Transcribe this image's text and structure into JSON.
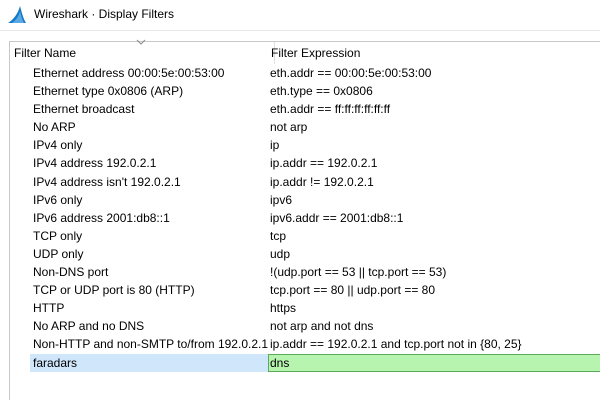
{
  "window": {
    "title": "Wireshark · Display Filters",
    "icon": "wireshark-fin-icon",
    "accent_color": "#1679c8"
  },
  "table": {
    "columns": {
      "name": "Filter Name",
      "expression": "Filter Expression"
    },
    "rows": [
      {
        "name": "Ethernet address 00:00:5e:00:53:00",
        "expression": "eth.addr == 00:00:5e:00:53:00"
      },
      {
        "name": "Ethernet type 0x0806 (ARP)",
        "expression": "eth.type == 0x0806"
      },
      {
        "name": "Ethernet broadcast",
        "expression": "eth.addr == ff:ff:ff:ff:ff:ff"
      },
      {
        "name": "No ARP",
        "expression": "not arp"
      },
      {
        "name": "IPv4 only",
        "expression": "ip"
      },
      {
        "name": "IPv4 address 192.0.2.1",
        "expression": "ip.addr == 192.0.2.1"
      },
      {
        "name": "IPv4 address isn't 192.0.2.1",
        "expression": "ip.addr != 192.0.2.1"
      },
      {
        "name": "IPv6 only",
        "expression": "ipv6"
      },
      {
        "name": "IPv6 address 2001:db8::1",
        "expression": "ipv6.addr == 2001:db8::1"
      },
      {
        "name": "TCP only",
        "expression": "tcp"
      },
      {
        "name": "UDP only",
        "expression": "udp"
      },
      {
        "name": "Non-DNS port",
        "expression": "!(udp.port == 53 || tcp.port == 53)"
      },
      {
        "name": "TCP or UDP port is 80 (HTTP)",
        "expression": "tcp.port == 80 || udp.port == 80"
      },
      {
        "name": "HTTP",
        "expression": "https"
      },
      {
        "name": "No ARP and no DNS",
        "expression": "not arp and not dns"
      },
      {
        "name": "Non-HTTP and non-SMTP to/from 192.0.2.1",
        "expression": "ip.addr == 192.0.2.1 and tcp.port not in {80, 25}"
      },
      {
        "name": "faradars",
        "expression": "dns",
        "selected": true,
        "expression_valid": true
      }
    ]
  },
  "colors": {
    "selection_name_bg": "#cfe6fb",
    "valid_expression_bg": "#b6f4b0"
  }
}
